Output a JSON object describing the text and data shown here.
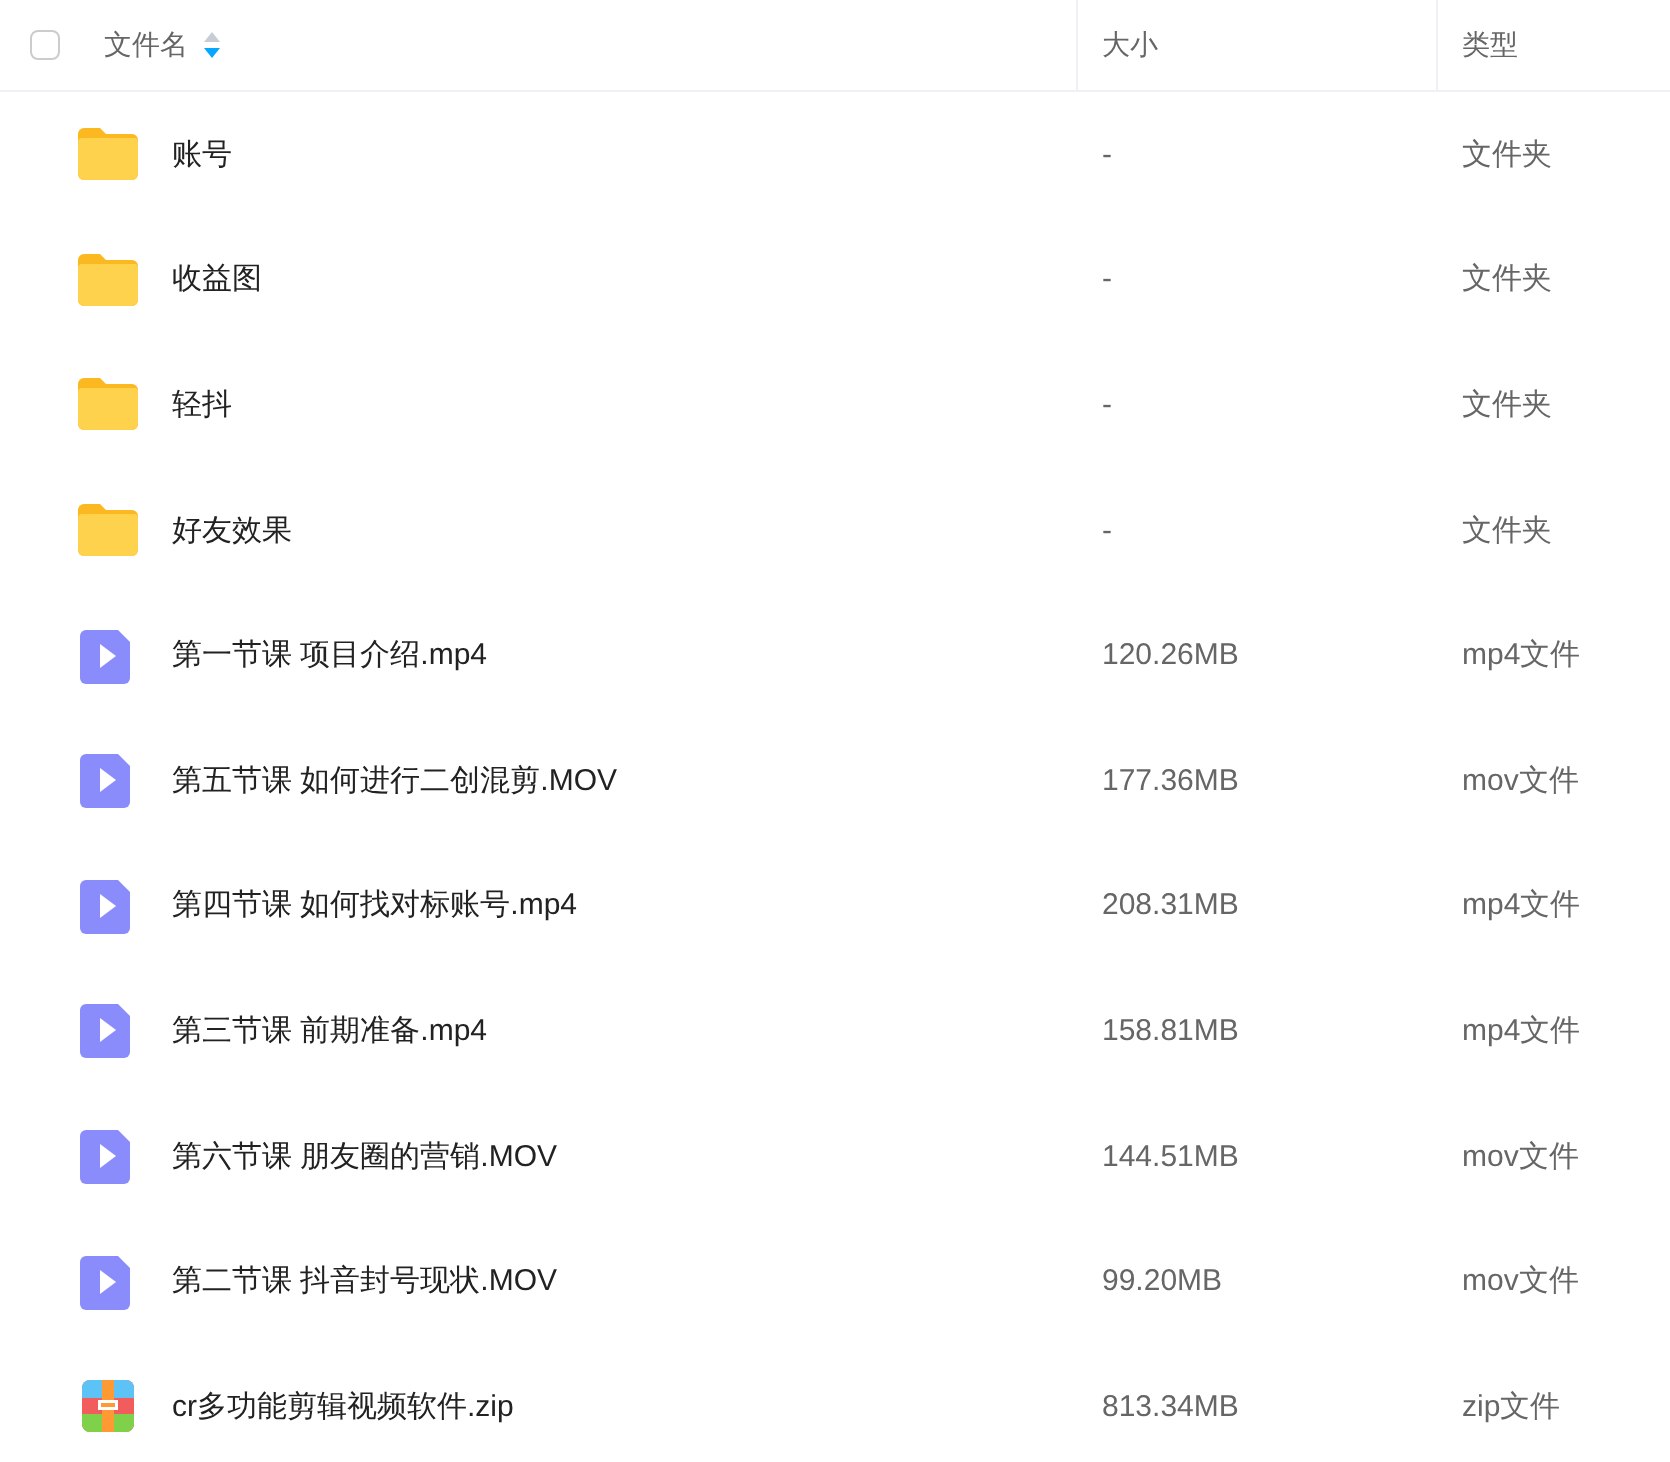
{
  "header": {
    "select_all": {
      "checked": false
    },
    "columns": [
      {
        "label": "文件名",
        "sort_descending": true
      },
      {
        "label": "大小"
      },
      {
        "label": "类型"
      }
    ]
  },
  "rows": [
    {
      "kind": "folder",
      "name": "账号",
      "size": "-",
      "type": "文件夹"
    },
    {
      "kind": "folder",
      "name": "收益图",
      "size": "-",
      "type": "文件夹"
    },
    {
      "kind": "folder",
      "name": "轻抖",
      "size": "-",
      "type": "文件夹"
    },
    {
      "kind": "folder",
      "name": "好友效果",
      "size": "-",
      "type": "文件夹"
    },
    {
      "kind": "video",
      "name": "第一节课 项目介绍.mp4",
      "size": "120.26MB",
      "type": "mp4文件"
    },
    {
      "kind": "video",
      "name": "第五节课 如何进行二创混剪.MOV",
      "size": "177.36MB",
      "type": "mov文件"
    },
    {
      "kind": "video",
      "name": "第四节课 如何找对标账号.mp4",
      "size": "208.31MB",
      "type": "mp4文件"
    },
    {
      "kind": "video",
      "name": "第三节课 前期准备.mp4",
      "size": "158.81MB",
      "type": "mp4文件"
    },
    {
      "kind": "video",
      "name": "第六节课 朋友圈的营销.MOV",
      "size": "144.51MB",
      "type": "mov文件"
    },
    {
      "kind": "video",
      "name": "第二节课 抖音封号现状.MOV",
      "size": "99.20MB",
      "type": "mov文件"
    },
    {
      "kind": "zip",
      "name": "cr多功能剪辑视频软件.zip",
      "size": "813.34MB",
      "type": "zip文件"
    }
  ]
}
